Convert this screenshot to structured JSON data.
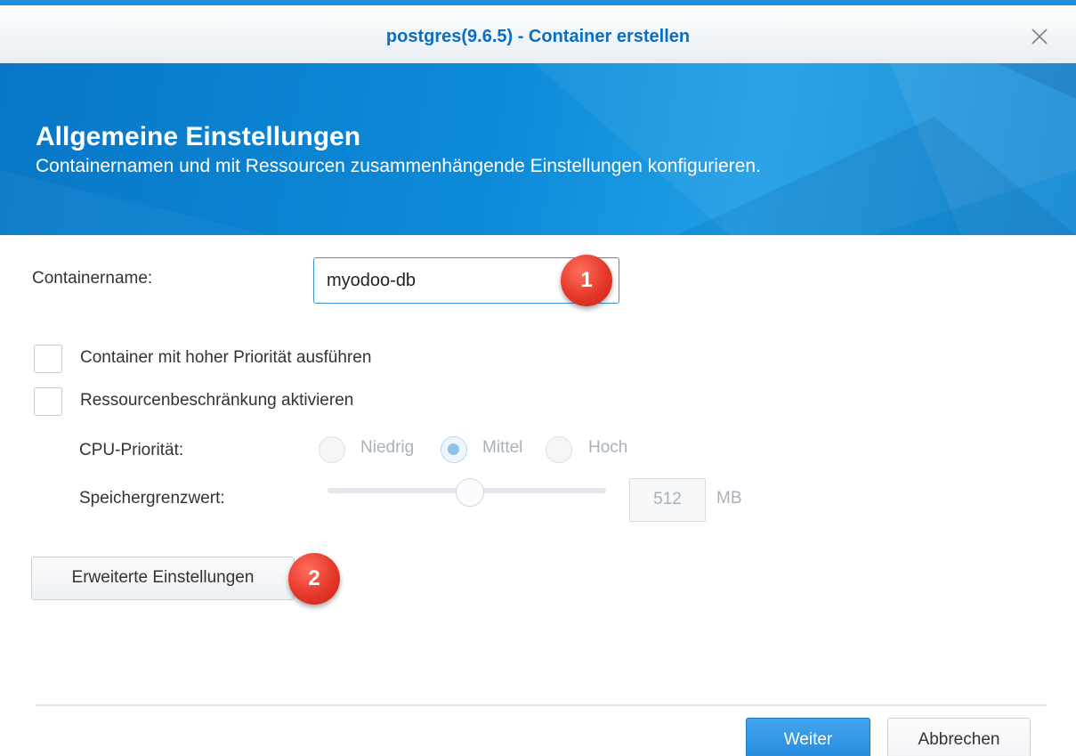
{
  "window": {
    "title": "postgres(9.6.5) - Container erstellen",
    "close_icon": "close-icon"
  },
  "banner": {
    "title": "Allgemeine Einstellungen",
    "subtitle": "Containernamen und mit Ressourcen zusammenhängende Einstellungen konfigurieren."
  },
  "form": {
    "container_name_label": "Containername:",
    "container_name_value": "myodoo-db",
    "high_priority_label": "Container mit hoher Priorität ausführen",
    "high_priority_checked": false,
    "resource_limit_label": "Ressourcenbeschränkung aktivieren",
    "resource_limit_checked": false,
    "cpu_priority_label": "CPU-Priorität:",
    "cpu_options": [
      "Niedrig",
      "Mittel",
      "Hoch"
    ],
    "cpu_selected": "Mittel",
    "memory_label": "Speichergrenzwert:",
    "memory_value": "512",
    "memory_unit": "MB"
  },
  "annotations": {
    "badge_1": "1",
    "badge_2": "2"
  },
  "buttons": {
    "advanced": "Erweiterte Einstellungen",
    "next": "Weiter",
    "cancel": "Abbrechen"
  },
  "colors": {
    "accent": "#1a8fdc",
    "title": "#0a6fc2",
    "badge": "#e5372a",
    "primary_button": "#2489dc"
  }
}
